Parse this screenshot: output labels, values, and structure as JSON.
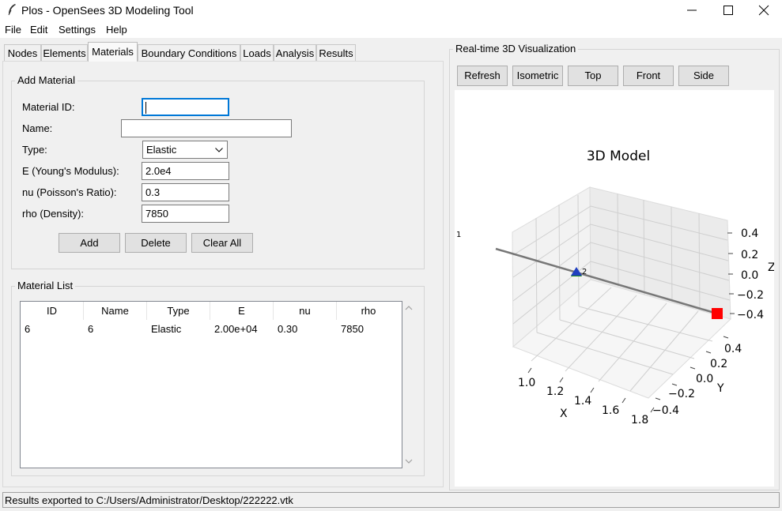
{
  "window": {
    "title": "Plos - OpenSees 3D Modeling Tool",
    "app_icon": "feather-icon"
  },
  "menu": [
    "File",
    "Edit",
    "Settings",
    "Help"
  ],
  "tabs": [
    {
      "label": "Nodes",
      "active": false
    },
    {
      "label": "Elements",
      "active": false
    },
    {
      "label": "Materials",
      "active": true
    },
    {
      "label": "Boundary Conditions",
      "active": false
    },
    {
      "label": "Loads",
      "active": false
    },
    {
      "label": "Analysis",
      "active": false
    },
    {
      "label": "Results",
      "active": false
    }
  ],
  "add_material": {
    "title": "Add Material",
    "fields": {
      "material_id": {
        "label": "Material ID:",
        "value": ""
      },
      "name": {
        "label": "Name:",
        "value": ""
      },
      "type": {
        "label": "Type:",
        "value": "Elastic"
      },
      "E": {
        "label": "E (Young's Modulus):",
        "value": "2.0e4"
      },
      "nu": {
        "label": "nu (Poisson's Ratio):",
        "value": "0.3"
      },
      "rho": {
        "label": "rho (Density):",
        "value": "7850"
      }
    },
    "buttons": {
      "add": "Add",
      "delete": "Delete",
      "clear_all": "Clear All"
    }
  },
  "material_list": {
    "title": "Material List",
    "columns": [
      "ID",
      "Name",
      "Type",
      "E",
      "nu",
      "rho"
    ],
    "rows": [
      [
        "6",
        "6",
        "Elastic",
        "2.00e+04",
        "0.30",
        "7850"
      ]
    ]
  },
  "visualization": {
    "title": "Real-time 3D Visualization",
    "buttons": {
      "refresh": "Refresh",
      "isometric": "Isometric",
      "top": "Top",
      "front": "Front",
      "side": "Side"
    },
    "plot": {
      "title": "3D Model",
      "x_label": "X",
      "y_label": "Y",
      "z_label": "Z",
      "x_ticks": [
        "1.0",
        "1.2",
        "1.4",
        "1.6",
        "1.8"
      ],
      "y_ticks": [
        "0.4",
        "0.2",
        "0.0",
        "−0.2",
        "−0.4"
      ],
      "z_ticks": [
        "0.4",
        "0.2",
        "0.0",
        "−0.2",
        "−0.4"
      ],
      "node_labels": [
        "1",
        "2"
      ],
      "colors": {
        "line": "#777777",
        "node_blue": "#1f3fbf",
        "node_green": "#1a8a1a",
        "load_red": "#ff0000"
      }
    }
  },
  "status": "Results exported to C:/Users/Administrator/Desktop/222222.vtk"
}
